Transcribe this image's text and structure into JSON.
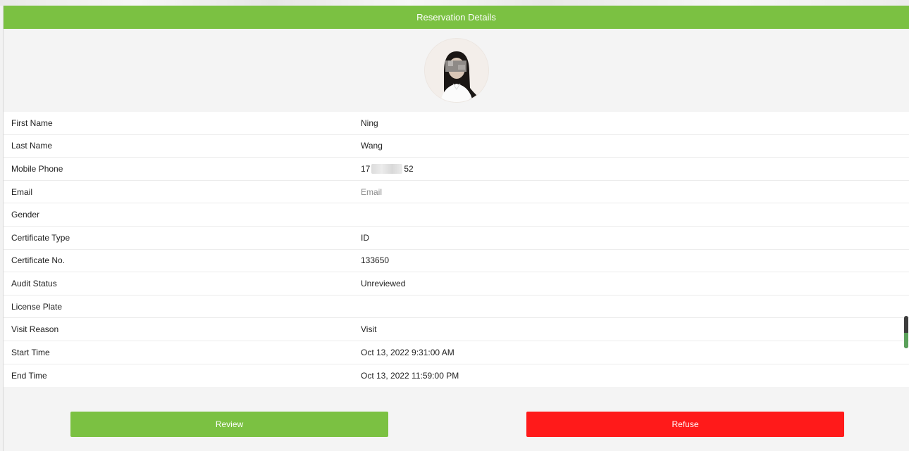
{
  "header": {
    "title": "Reservation Details"
  },
  "fields": [
    {
      "label": "First Name",
      "value": "Ning"
    },
    {
      "label": "Last Name",
      "value": "Wang"
    },
    {
      "label": "Mobile Phone",
      "value_prefix": "17",
      "value_suffix": "52"
    },
    {
      "label": "Email",
      "placeholder": "Email"
    },
    {
      "label": "Gender",
      "value": ""
    },
    {
      "label": "Certificate Type",
      "value": "ID"
    },
    {
      "label": "Certificate No.",
      "value": "133650"
    },
    {
      "label": "Audit Status",
      "value": "Unreviewed"
    },
    {
      "label": "License Plate",
      "value": ""
    },
    {
      "label": "Visit Reason",
      "value": "Visit"
    },
    {
      "label": "Start Time",
      "value": "Oct 13, 2022 9:31:00 AM"
    },
    {
      "label": "End Time",
      "value": "Oct 13, 2022 11:59:00 PM"
    }
  ],
  "actions": {
    "review_label": "Review",
    "refuse_label": "Refuse"
  },
  "colors": {
    "accent": "#7bc142",
    "danger": "#ff1a1a"
  }
}
